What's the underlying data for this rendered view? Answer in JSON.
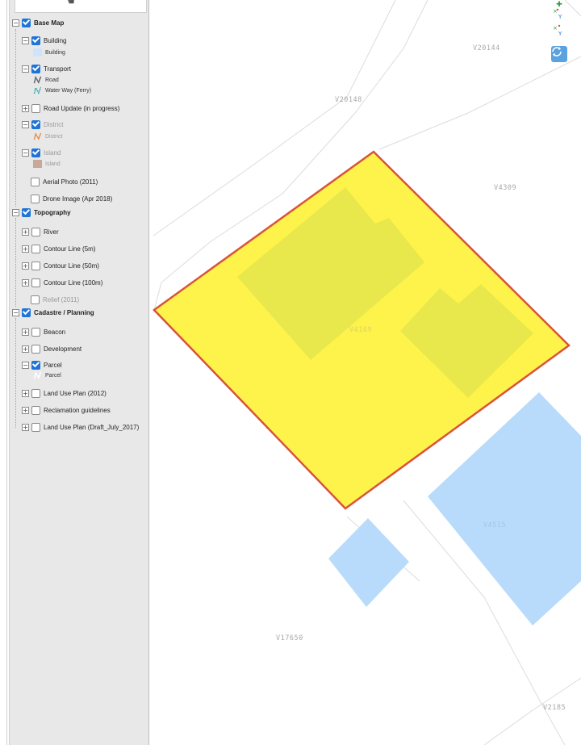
{
  "layers": {
    "base_map": {
      "label": "Base Map",
      "checked": true
    },
    "building": {
      "label": "Building",
      "legend": "Building",
      "checked": true
    },
    "transport": {
      "label": "Transport",
      "legend_road": "Road",
      "legend_ferry": "Water Way (Ferry)",
      "checked": true
    },
    "road_update": {
      "label": "Road Update (in progress)",
      "checked": false
    },
    "district": {
      "label": "District",
      "legend": "District",
      "checked": true
    },
    "island": {
      "label": "Island",
      "legend": "Island",
      "checked": true
    },
    "aerial_photo": {
      "label": "Aerial Photo (2011)",
      "checked": false
    },
    "drone_image": {
      "label": "Drone Image (Apr 2018)",
      "checked": false
    },
    "topography": {
      "label": "Topography",
      "checked": true
    },
    "river": {
      "label": "River",
      "checked": false
    },
    "contour_5m": {
      "label": "Contour Line (5m)",
      "checked": false
    },
    "contour_50m": {
      "label": "Contour Line (50m)",
      "checked": false
    },
    "contour_100m": {
      "label": "Contour Line (100m)",
      "checked": false
    },
    "relief": {
      "label": "Relief (2011)",
      "checked": false
    },
    "cadastre": {
      "label": "Cadastre / Planning",
      "checked": true
    },
    "beacon": {
      "label": "Beacon",
      "checked": false
    },
    "development": {
      "label": "Development",
      "checked": false
    },
    "parcel": {
      "label": "Parcel",
      "legend": "Parcel",
      "checked": true
    },
    "land_use_2012": {
      "label": "Land Use Plan (2012)",
      "checked": false
    },
    "reclamation": {
      "label": "Reclamation guidelines",
      "checked": false
    },
    "land_use_draft": {
      "label": "Land Use Plan (Draft_July_2017)",
      "checked": false
    }
  },
  "map": {
    "parcel_labels": {
      "v20144": "V20144",
      "v20148": "V20148",
      "v4309": "V4309",
      "v4169": "V4169",
      "v4515": "V4515",
      "v17650": "V17650",
      "v2185": "V2185"
    },
    "colors": {
      "selected_parcel_fill": "#fef34a",
      "selected_parcel_outline": "#d9533b",
      "building_fill": "#b9dbfb",
      "building_on_selection": "#e8e84c",
      "parcel_line": "#dcdcdc"
    }
  },
  "icons": {
    "pan_tool": "hand-icon",
    "xy_tool_1": "xy-coordinate-icon",
    "xy_tool_2": "xy-coordinate-icon",
    "refresh_tool": "refresh-icon"
  }
}
